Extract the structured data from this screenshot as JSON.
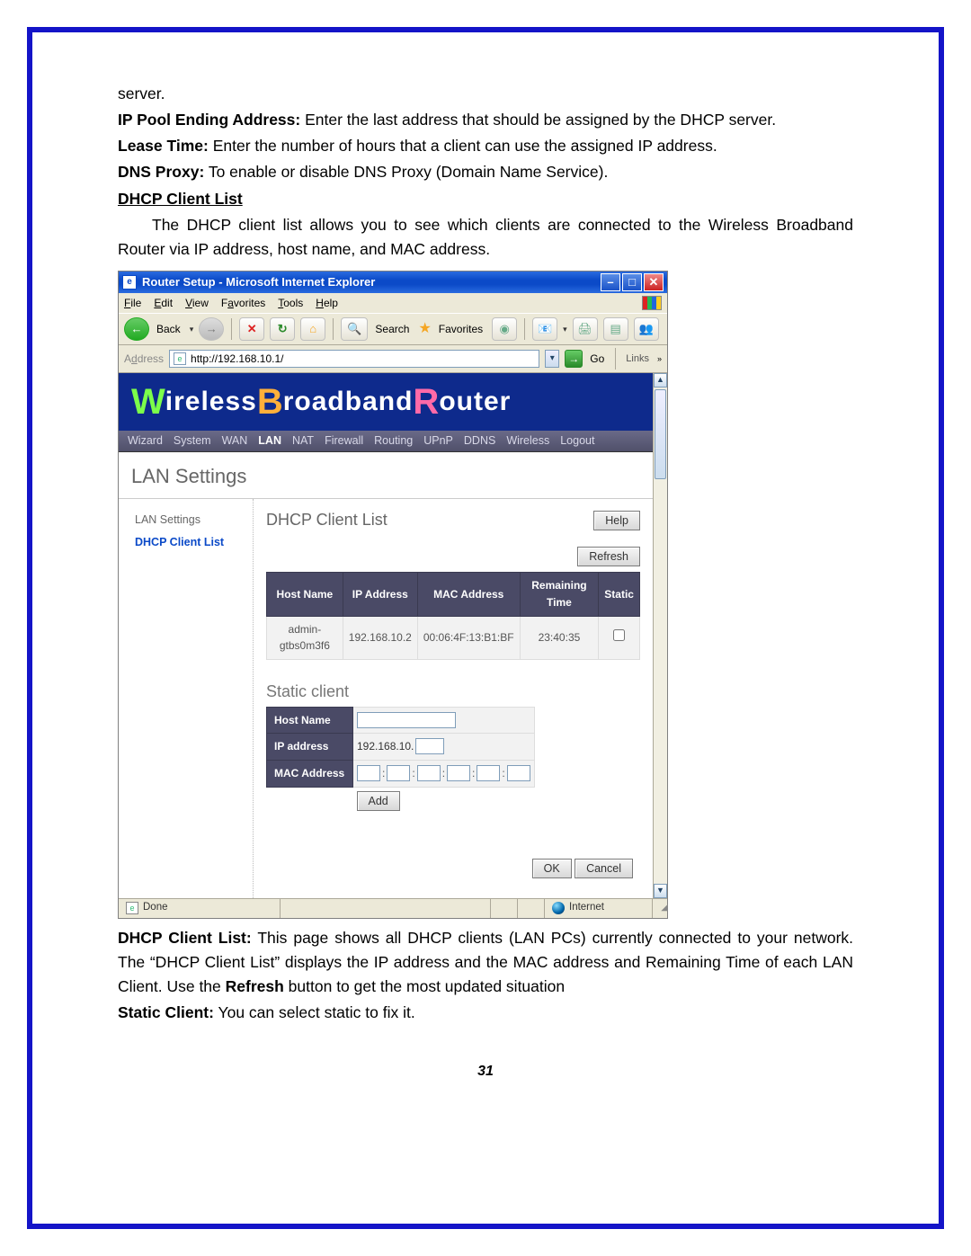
{
  "intro": {
    "server_tail": "server.",
    "ip_pool_label": "IP Pool Ending Address:",
    "ip_pool_text": " Enter the last address that should be assigned by the DHCP server.",
    "lease_label": "Lease Time:",
    "lease_text": " Enter the number of hours that a client can use the assigned IP address.",
    "dns_label": "DNS Proxy:",
    "dns_text": " To enable or disable DNS Proxy (Domain Name Service)."
  },
  "section": {
    "heading": "DHCP Client List",
    "desc1": "The DHCP client list allows you to see which clients are connected to the Wireless Broadband Router via IP address, host name, and MAC address."
  },
  "ie": {
    "title": "Router Setup - Microsoft Internet Explorer",
    "menus": [
      "File",
      "Edit",
      "View",
      "Favorites",
      "Tools",
      "Help"
    ],
    "back": "Back",
    "search": "Search",
    "favorites": "Favorites",
    "address_lbl": "Address",
    "url": "http://192.168.10.1/",
    "go": "Go",
    "links": "Links",
    "status_done": "Done",
    "status_zone": "Internet"
  },
  "router": {
    "banner_w": "W",
    "banner_ireless": "ireless ",
    "banner_b": "B",
    "banner_roadband": "roadband ",
    "banner_r": "R",
    "banner_outer": "outer",
    "tabs": [
      "Wizard",
      "System",
      "WAN",
      "LAN",
      "NAT",
      "Firewall",
      "Routing",
      "UPnP",
      "DDNS",
      "Wireless",
      "Logout"
    ],
    "tabs_sel": "LAN",
    "page_title": "LAN Settings",
    "left1": "LAN Settings",
    "left2": "DHCP Client List",
    "content_title": "DHCP Client List",
    "help": "Help",
    "refresh": "Refresh",
    "cols": [
      "Host Name",
      "IP Address",
      "MAC Address",
      "Remaining Time",
      "Static"
    ],
    "row": {
      "host": "admin-gtbs0m3f6",
      "ip": "192.168.10.2",
      "mac": "00:06:4F:13:B1:BF",
      "time": "23:40:35"
    },
    "static_title": "Static client",
    "sc_host": "Host Name",
    "sc_ip": "IP address",
    "sc_mac": "MAC Address",
    "ip_prefix": "192.168.10.",
    "add": "Add",
    "ok": "OK",
    "cancel": "Cancel"
  },
  "outro": {
    "dhcp_label": "DHCP Client List:",
    "dhcp_text1": " This page shows all DHCP clients (LAN PCs) currently connected to your network. The “DHCP Client List” displays the IP address and the MAC address and Remaining Time of each LAN Client. Use the ",
    "refresh_bold": "Refresh",
    "dhcp_text2": " button to get the most updated situation",
    "static_label": "Static Client:",
    "static_text": " You can select static to fix it."
  },
  "page_number": "31"
}
